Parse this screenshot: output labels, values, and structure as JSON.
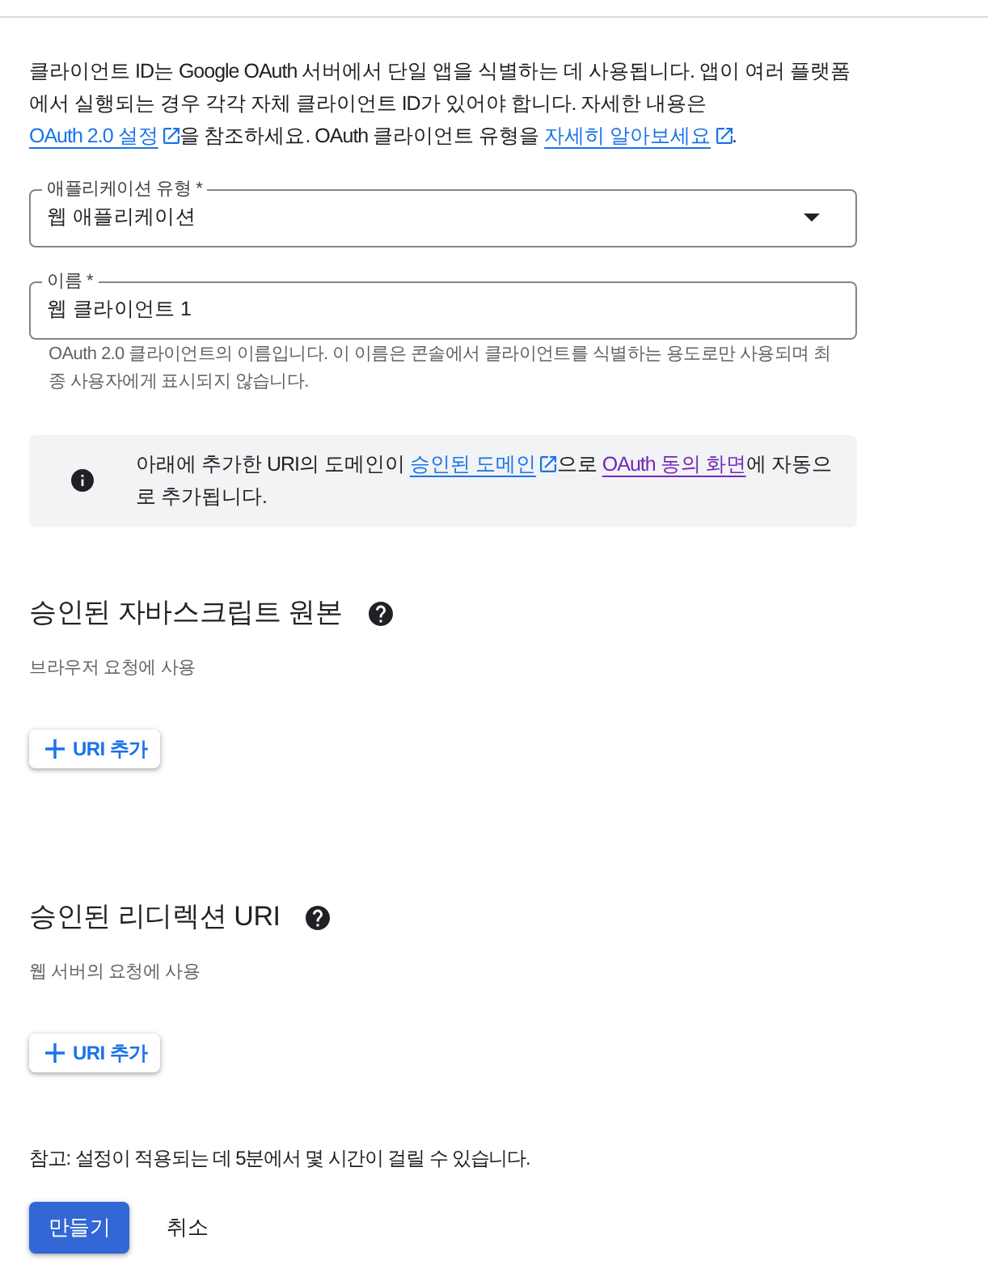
{
  "intro": {
    "segments": [
      {
        "kind": "text",
        "text": "클라이언트 ID는 Google OAuth 서버에서 단일 앱을 식별하는 데 사용됩니다. 앱이 여러 플랫폼에서 실행되는 경우 각각 자체 클라이언트 ID가 있어야 합니다. 자세한 내용은 "
      },
      {
        "kind": "link",
        "text": "OAuth 2.0 설정",
        "external": true,
        "visited": false
      },
      {
        "kind": "text",
        "text": "을 참조하세요. OAuth 클라이언트 유형을 "
      },
      {
        "kind": "link",
        "text": "자세히 알아보세요",
        "external": true,
        "visited": false
      },
      {
        "kind": "text",
        "text": "."
      }
    ]
  },
  "fields": [
    {
      "kind": "select",
      "label": "애플리케이션 유형 *",
      "value": "웹 애플리케이션"
    },
    {
      "kind": "text",
      "label": "이름 *",
      "value": "웹 클라이언트 1",
      "hint": "OAuth 2.0 클라이언트의 이름입니다. 이 이름은 콘솔에서 클라이언트를 식별하는 용도로만 사용되며 최종 사용자에게 표시되지 않습니다."
    }
  ],
  "notice": {
    "segments": [
      {
        "kind": "text",
        "text": "아래에 추가한 URI의 도메인이 "
      },
      {
        "kind": "link",
        "text": "승인된 도메인",
        "external": true,
        "visited": false
      },
      {
        "kind": "text",
        "text": "으로 "
      },
      {
        "kind": "link",
        "text": "OAuth 동의 화면",
        "external": false,
        "visited": true
      },
      {
        "kind": "text",
        "text": "에 자동으로 추가됩니다."
      }
    ]
  },
  "sections": [
    {
      "title": "승인된 자바스크립트 원본",
      "subtitle": "브라우저 요청에 사용",
      "button": "URI 추가"
    },
    {
      "title": "승인된 리디렉션 URI",
      "subtitle": "웹 서버의 요청에 사용",
      "button": "URI 추가"
    }
  ],
  "note": "참고: 설정이 적용되는 데 5분에서 몇 시간이 걸릴 수 있습니다.",
  "actions": [
    {
      "kind": "primary",
      "label": "만들기"
    },
    {
      "kind": "text",
      "label": "취소"
    }
  ]
}
